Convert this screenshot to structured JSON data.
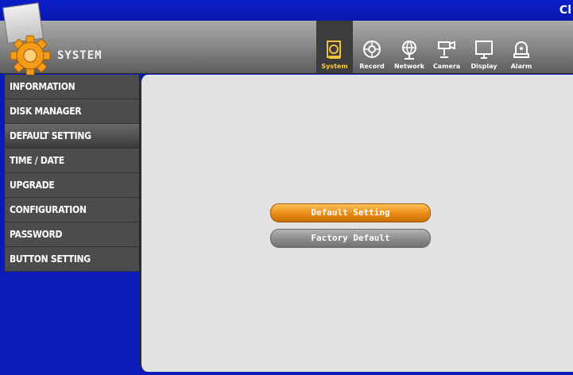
{
  "topbar": {
    "close_text": "Cl"
  },
  "header": {
    "title": "SYSTEM"
  },
  "nav": [
    {
      "label": "System",
      "icon": "system-icon",
      "active": true
    },
    {
      "label": "Record",
      "icon": "record-icon"
    },
    {
      "label": "Network",
      "icon": "network-icon"
    },
    {
      "label": "Camera",
      "icon": "camera-icon"
    },
    {
      "label": "Display",
      "icon": "display-icon"
    },
    {
      "label": "Alarm",
      "icon": "alarm-icon"
    }
  ],
  "sidebar": {
    "items": [
      {
        "label": "INFORMATION"
      },
      {
        "label": "DISK MANAGER"
      },
      {
        "label": "DEFAULT SETTING",
        "active": true
      },
      {
        "label": "TIME / DATE"
      },
      {
        "label": "UPGRADE"
      },
      {
        "label": "CONFIGURATION"
      },
      {
        "label": "PASSWORD"
      },
      {
        "label": "BUTTON SETTING"
      }
    ]
  },
  "panel": {
    "default_setting_label": "Default Setting",
    "factory_default_label": "Factory Default"
  },
  "colors": {
    "accent": "#f09a1c",
    "background_blue": "#0a1bb8",
    "active_nav": "#ffcc33"
  }
}
